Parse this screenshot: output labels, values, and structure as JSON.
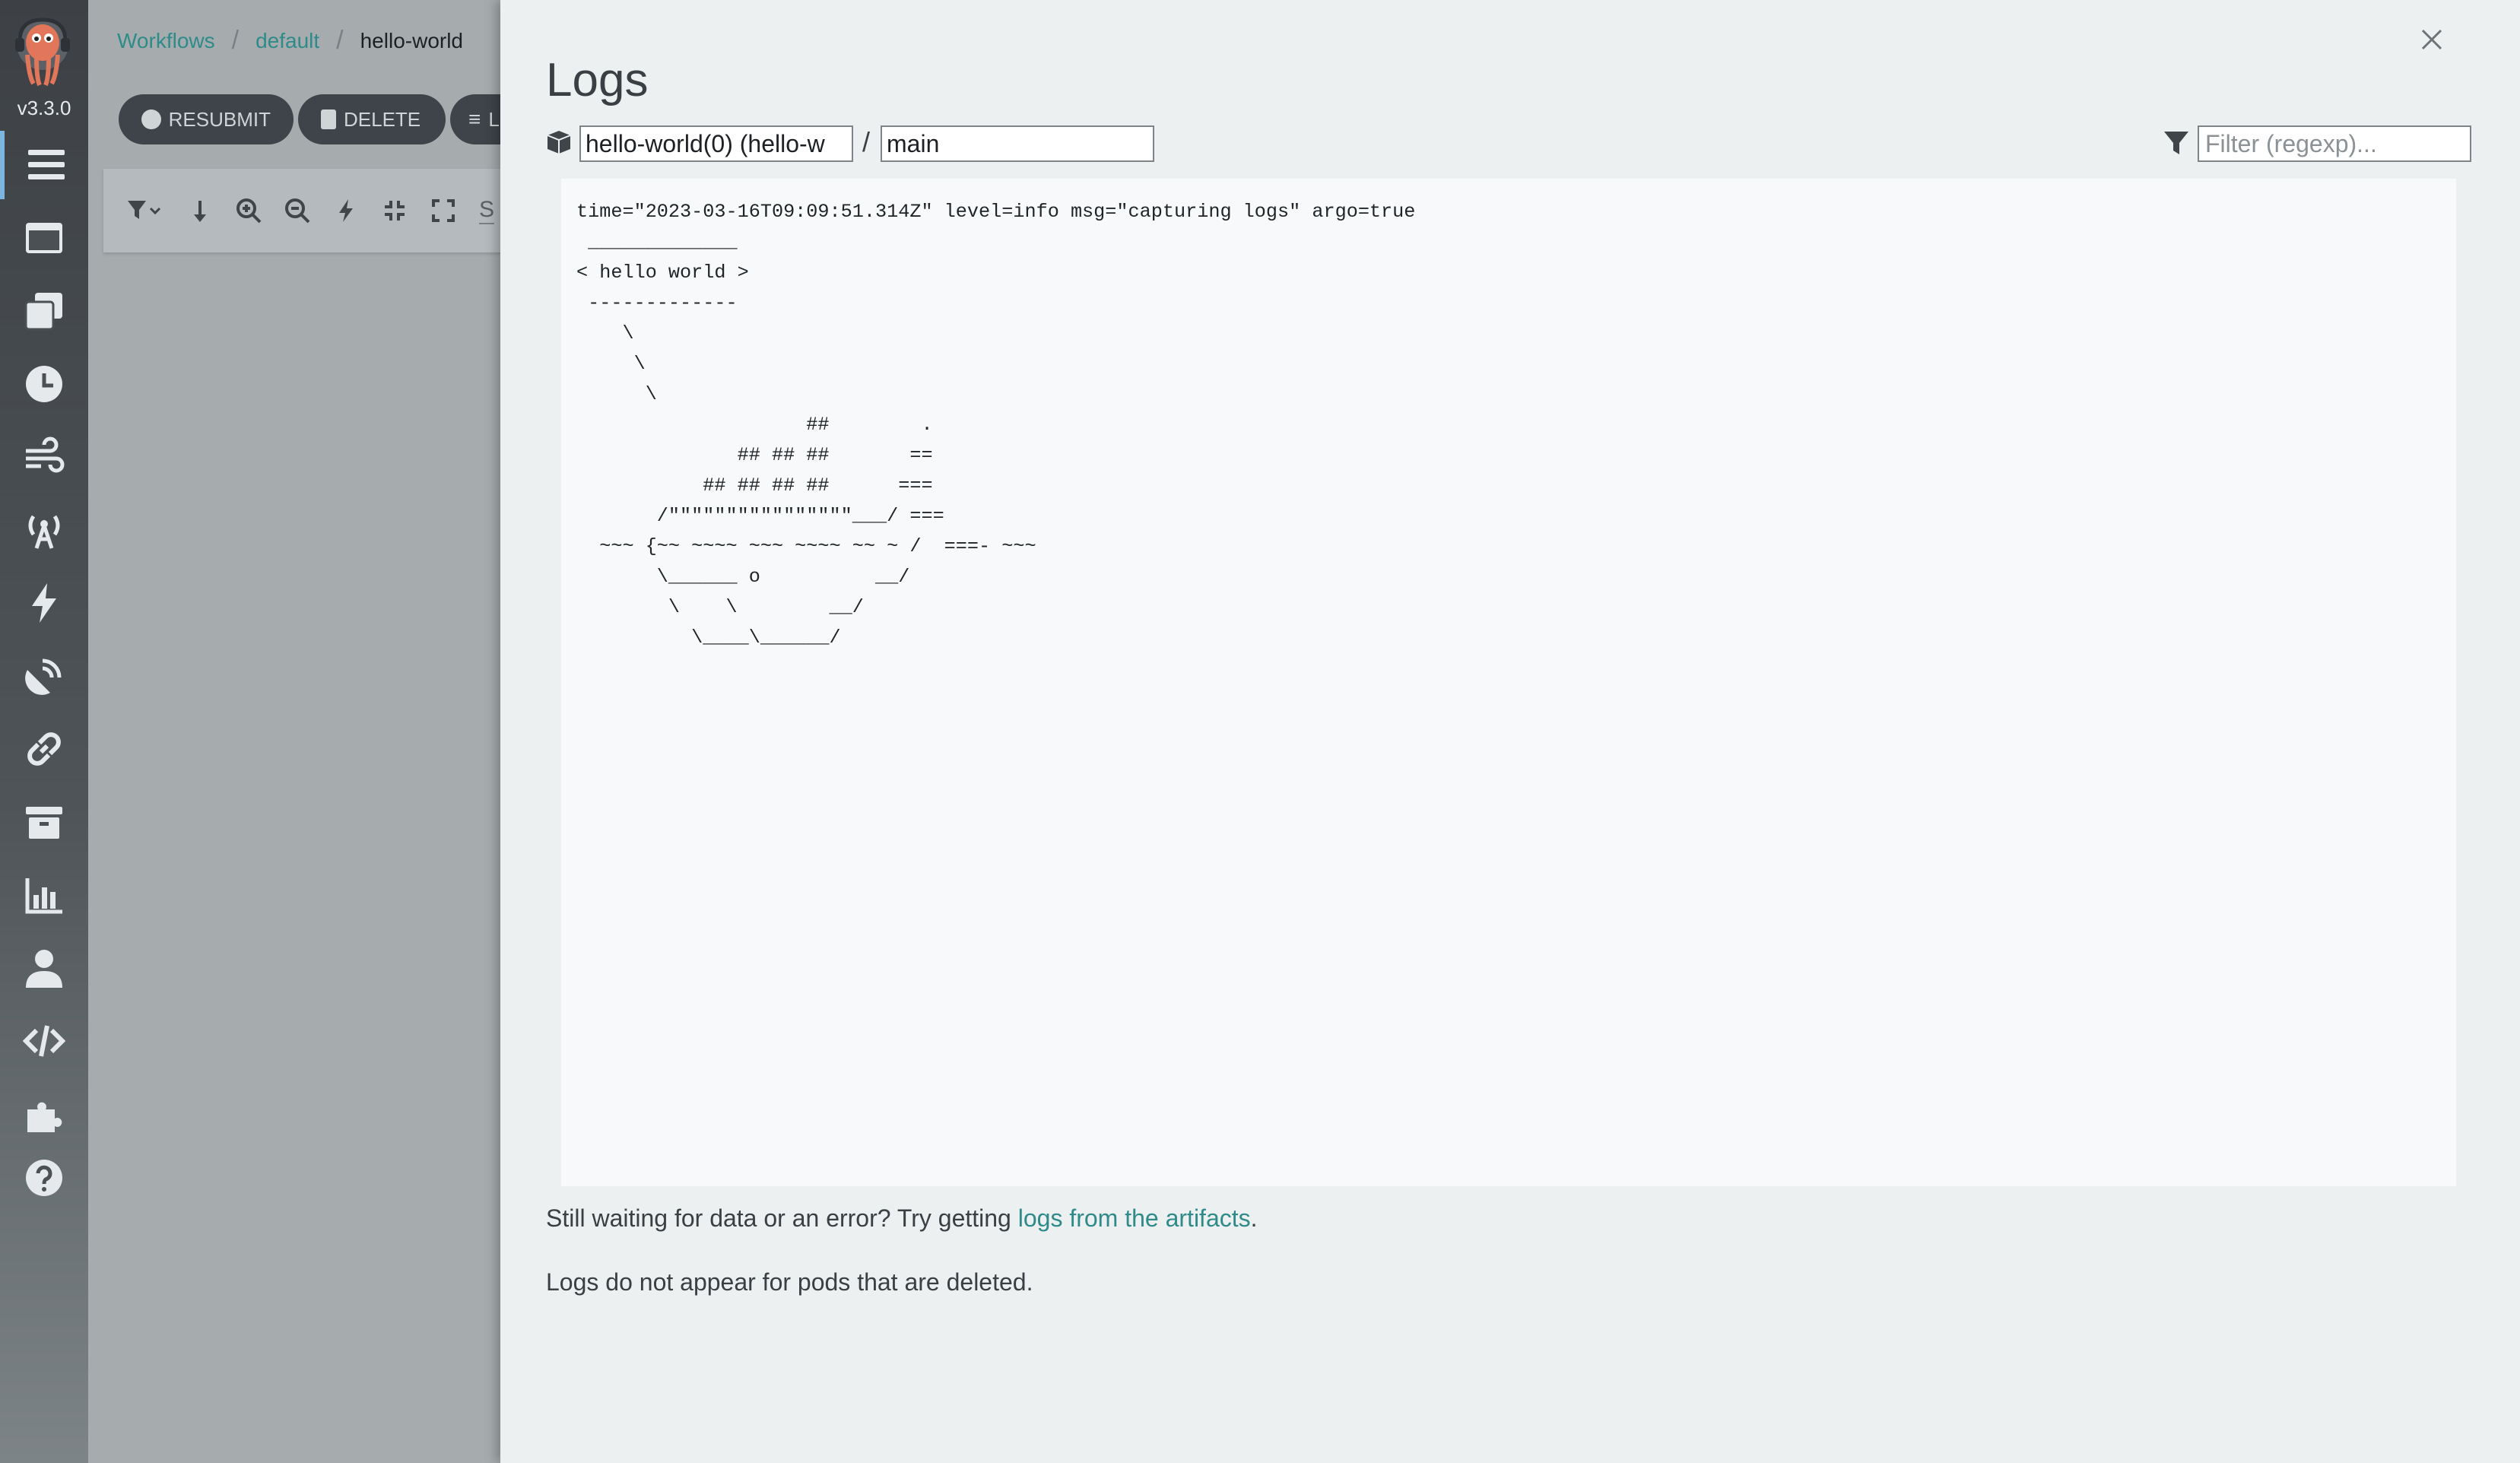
{
  "app": {
    "version": "v3.3.0",
    "logo_icon": "argo-octopus-logo"
  },
  "nav": {
    "items": [
      {
        "name": "nav-workflows",
        "icon": "list-icon",
        "active": true
      },
      {
        "name": "nav-workflow-templates",
        "icon": "window-icon"
      },
      {
        "name": "nav-cluster-workflow-templates",
        "icon": "clone-icon"
      },
      {
        "name": "nav-cron-workflows",
        "icon": "clock-icon"
      },
      {
        "name": "nav-event-flow",
        "icon": "wind-icon"
      },
      {
        "name": "nav-event-sources",
        "icon": "broadcast-tower-icon"
      },
      {
        "name": "nav-sensors",
        "icon": "bolt-icon"
      },
      {
        "name": "nav-event-flow-satellite",
        "icon": "satellite-dish-icon"
      },
      {
        "name": "nav-interop",
        "icon": "link-icon"
      },
      {
        "name": "nav-archived-workflows",
        "icon": "archive-icon"
      },
      {
        "name": "nav-reports",
        "icon": "chart-bar-icon"
      },
      {
        "name": "nav-user",
        "icon": "user-icon"
      },
      {
        "name": "nav-api-docs",
        "icon": "code-icon"
      },
      {
        "name": "nav-plugins",
        "icon": "puzzle-piece-icon"
      },
      {
        "name": "nav-help",
        "icon": "question-circle-icon"
      }
    ]
  },
  "breadcrumb": {
    "root": "Workflows",
    "namespace": "default",
    "current": "hello-world"
  },
  "actions": {
    "resubmit": "RESUBMIT",
    "delete": "DELETE",
    "logs_partial": "L"
  },
  "toolbar": {
    "search_partial": "S"
  },
  "logs": {
    "title": "Logs",
    "pod_select_value": "hello-world(0) (hello-w",
    "container_select_value": "main",
    "filter_placeholder": "Filter (regexp)...",
    "content": "time=\"2023-03-16T09:09:51.314Z\" level=info msg=\"capturing logs\" argo=true\n _____________\n< hello world >\n -------------\n    \\\n     \\\n      \\\n                    ##        .\n              ## ## ##       ==\n           ## ## ## ##      ===\n       /\"\"\"\"\"\"\"\"\"\"\"\"\"\"\"\"___/ ===\n  ~~~ {~~ ~~~~ ~~~ ~~~~ ~~ ~ /  ===- ~~~\n       \\______ o          __/\n        \\    \\        __/\n          \\____\\______/",
    "waiting_prefix": "Still waiting for data or an error? Try getting ",
    "waiting_link": "logs from the artifacts",
    "waiting_suffix": ".",
    "deleted_note": "Logs do not appear for pods that are deleted."
  },
  "colors": {
    "accent": "#2f8a8a",
    "nav_active": "#7cb5e0"
  }
}
